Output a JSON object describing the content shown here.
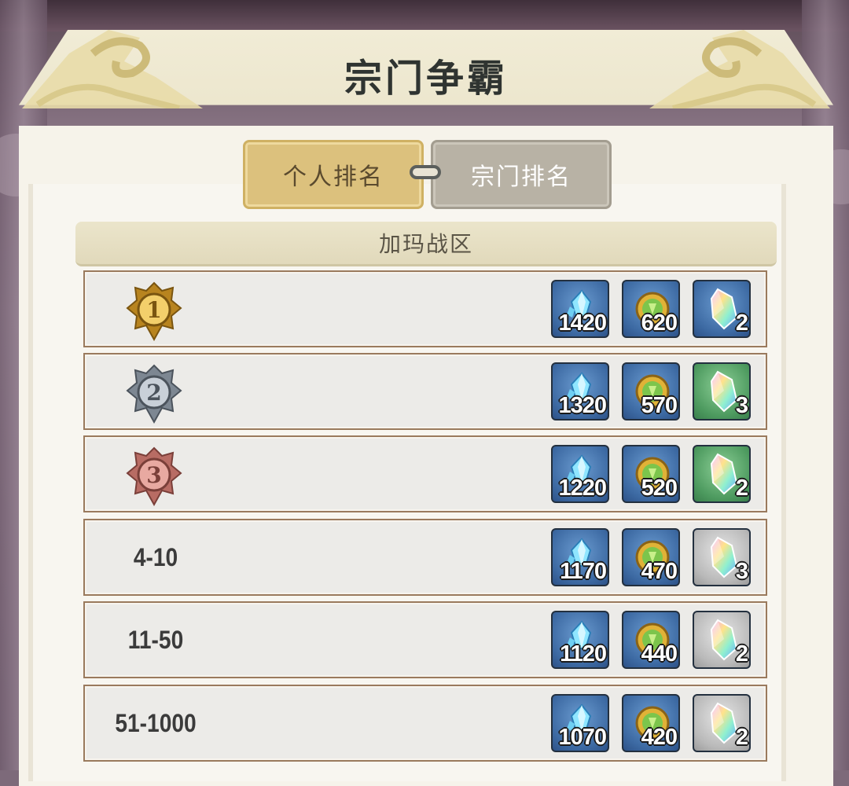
{
  "header": {
    "title": "宗门争霸"
  },
  "tabs": [
    {
      "label": "个人排名",
      "active": true
    },
    {
      "label": "宗门排名",
      "active": false
    }
  ],
  "region": {
    "name": "加玛战区"
  },
  "colors": {
    "tab_active": "#dcc17d",
    "tab_inactive": "#b8b2a5",
    "item_blue": "#3d6aa3",
    "item_green": "#4d9a5f",
    "item_grey": "#b9b9b9",
    "medal_gold": "#d8a93a",
    "medal_silver": "#8a939e",
    "medal_bronze": "#c07a73"
  },
  "rewards": [
    {
      "rank": "1",
      "medal": "gold-medal-icon",
      "items": [
        {
          "icon": "diamond-icon",
          "bg": "blue",
          "count": "1420"
        },
        {
          "icon": "gold-coin-icon",
          "bg": "blue",
          "count": "620"
        },
        {
          "icon": "crystal-icon",
          "bg": "blue",
          "count": "2"
        }
      ]
    },
    {
      "rank": "2",
      "medal": "silver-medal-icon",
      "items": [
        {
          "icon": "diamond-icon",
          "bg": "blue",
          "count": "1320"
        },
        {
          "icon": "gold-coin-icon",
          "bg": "blue",
          "count": "570"
        },
        {
          "icon": "crystal-icon",
          "bg": "green",
          "count": "3"
        }
      ]
    },
    {
      "rank": "3",
      "medal": "bronze-medal-icon",
      "items": [
        {
          "icon": "diamond-icon",
          "bg": "blue",
          "count": "1220"
        },
        {
          "icon": "gold-coin-icon",
          "bg": "blue",
          "count": "520"
        },
        {
          "icon": "crystal-icon",
          "bg": "green",
          "count": "2"
        }
      ]
    },
    {
      "rank": "4-10",
      "medal": "",
      "items": [
        {
          "icon": "diamond-icon",
          "bg": "blue",
          "count": "1170"
        },
        {
          "icon": "gold-coin-icon",
          "bg": "blue",
          "count": "470"
        },
        {
          "icon": "crystal-icon",
          "bg": "grey",
          "count": "3"
        }
      ]
    },
    {
      "rank": "11-50",
      "medal": "",
      "items": [
        {
          "icon": "diamond-icon",
          "bg": "blue",
          "count": "1120"
        },
        {
          "icon": "gold-coin-icon",
          "bg": "blue",
          "count": "440"
        },
        {
          "icon": "crystal-icon",
          "bg": "grey",
          "count": "2"
        }
      ]
    },
    {
      "rank": "51-1000",
      "medal": "",
      "items": [
        {
          "icon": "diamond-icon",
          "bg": "blue",
          "count": "1070"
        },
        {
          "icon": "gold-coin-icon",
          "bg": "blue",
          "count": "420"
        },
        {
          "icon": "crystal-icon",
          "bg": "grey",
          "count": "2"
        }
      ]
    }
  ]
}
